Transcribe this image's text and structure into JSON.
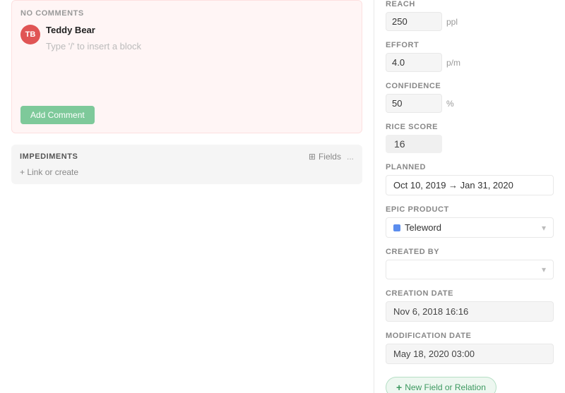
{
  "left": {
    "comments": {
      "no_comments_label": "NO COMMENTS",
      "user": {
        "initials": "TB",
        "name": "Teddy Bear"
      },
      "placeholder": "Type '/' to insert a block",
      "add_comment_label": "Add Comment"
    },
    "impediments": {
      "title": "IMPEDIMENTS",
      "fields_label": "Fields",
      "more_icon": "...",
      "link_or_create": "+ Link or create"
    }
  },
  "right": {
    "reach": {
      "label": "REACH",
      "value": "250",
      "unit": "ppl"
    },
    "effort": {
      "label": "EFFORT",
      "value": "4.0",
      "unit": "p/m"
    },
    "confidence": {
      "label": "CONFIDENCE",
      "value": "50",
      "unit": "%"
    },
    "rice_score": {
      "label": "RICE SCORE",
      "value": "16"
    },
    "planned": {
      "label": "PLANNED",
      "value": "Oct 10, 2019 → Jan 31, 2020"
    },
    "epic_product": {
      "label": "EPIC PRODUCT",
      "value": "Teleword"
    },
    "created_by": {
      "label": "CREATED BY",
      "value": ""
    },
    "creation_date": {
      "label": "CREATION DATE",
      "value": "Nov 6, 2018 16:16"
    },
    "modification_date": {
      "label": "MODIFICATION DATE",
      "value": "May 18, 2020 03:00"
    },
    "add_field_btn": {
      "label": "+ New Field or Relation"
    }
  }
}
